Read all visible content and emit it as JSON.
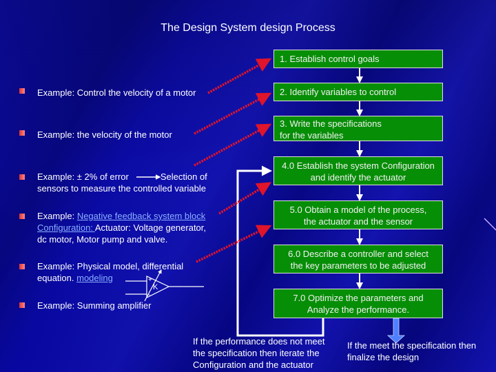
{
  "title": "The Design System design Process",
  "steps": [
    {
      "label": "1. Establish control goals"
    },
    {
      "label": "2. Identify variables to control"
    },
    {
      "line1": "3. Write the specifications",
      "line2": "for the variables"
    },
    {
      "line1": "4.0 Establish the system Configuration",
      "line2": "and identify the actuator"
    },
    {
      "line1": "5.0 Obtain a model of the process,",
      "line2": "the actuator and the sensor"
    },
    {
      "line1": "6.0 Describe a controller and select",
      "line2": "the key parameters to be adjusted"
    },
    {
      "line1": "7.0 Optimize the parameters and",
      "line2": "Analyze the performance."
    }
  ],
  "examples": [
    {
      "text": "Example: Control the velocity of a motor"
    },
    {
      "text": "Example: the velocity of the motor"
    },
    {
      "part1": "Example: ± 2% of error",
      "part2": "Selection of",
      "line2": "sensors to measure the controlled variable"
    },
    {
      "prefix": "Example: ",
      "link1": "Negative feedback system block",
      "link2": "Configuration: ",
      "rest": "Actuator: Voltage generator,",
      "line3": "dc  motor, Motor pump and valve."
    },
    {
      "line1": "Example: Physical model, differential",
      "line2_prefix": "equation. ",
      "link": "modeling"
    },
    {
      "text": "Example: Summing amplifier"
    }
  ],
  "amplifier": {
    "plus": "+",
    "minus": "-",
    "gain": "K"
  },
  "captions": {
    "iterate": [
      "If the performance does not meet",
      "the specification then iterate the",
      "Configuration and the actuator"
    ],
    "finalize": [
      "If the meet  the specification then",
      "finalize the design"
    ]
  },
  "colors": {
    "background": "#06068f",
    "box_fill": "#078e07",
    "arrow_dotted": "#e0142a",
    "finalize_arrow": "#4f7fff",
    "link": "#8ab0ff"
  }
}
